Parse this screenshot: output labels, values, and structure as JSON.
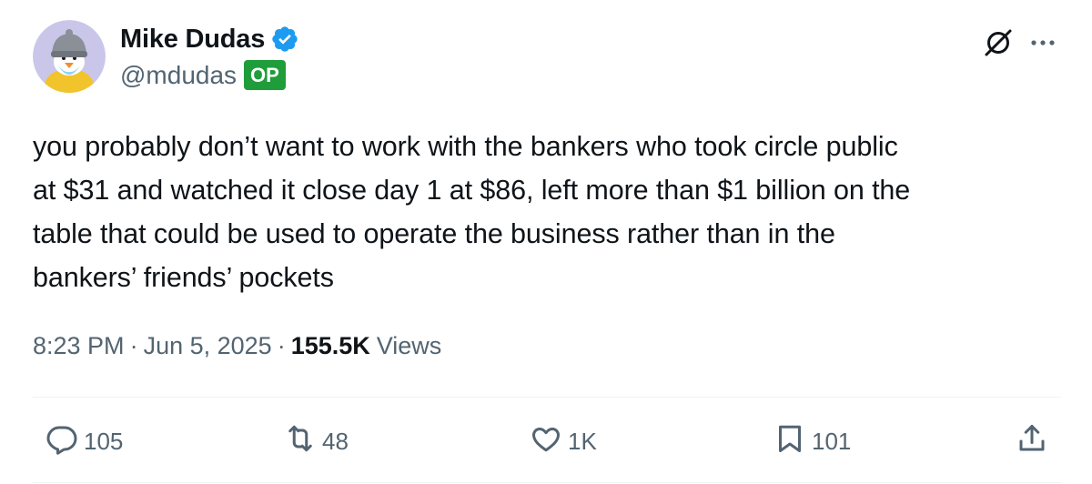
{
  "author": {
    "display_name": "Mike Dudas",
    "handle": "@mdudas",
    "badge": "OP",
    "verified": true
  },
  "icons": {
    "verified": "verified-badge-icon",
    "grok": "grok-icon",
    "more": "more-icon",
    "reply": "reply-icon",
    "repost": "repost-icon",
    "like": "like-icon",
    "bookmark": "bookmark-icon",
    "share": "share-icon"
  },
  "colors": {
    "text": "#0f1419",
    "secondary": "#536471",
    "verified": "#1d9bf0",
    "op_badge": "#1f9d3a"
  },
  "tweet": {
    "text": "you probably don’t want to work with the bankers who took circle public\nat $31 and watched it close day 1 at $86, left more than $1 billion on the\ntable that could be used to operate the business rather than in the\nbankers’ friends’ pockets"
  },
  "meta": {
    "time": "8:23 PM",
    "separator": "·",
    "date": "Jun 5, 2025",
    "views_count": "155.5K",
    "views_label": "Views"
  },
  "actions": {
    "replies": "105",
    "reposts": "48",
    "likes": "1K",
    "bookmarks": "101"
  }
}
